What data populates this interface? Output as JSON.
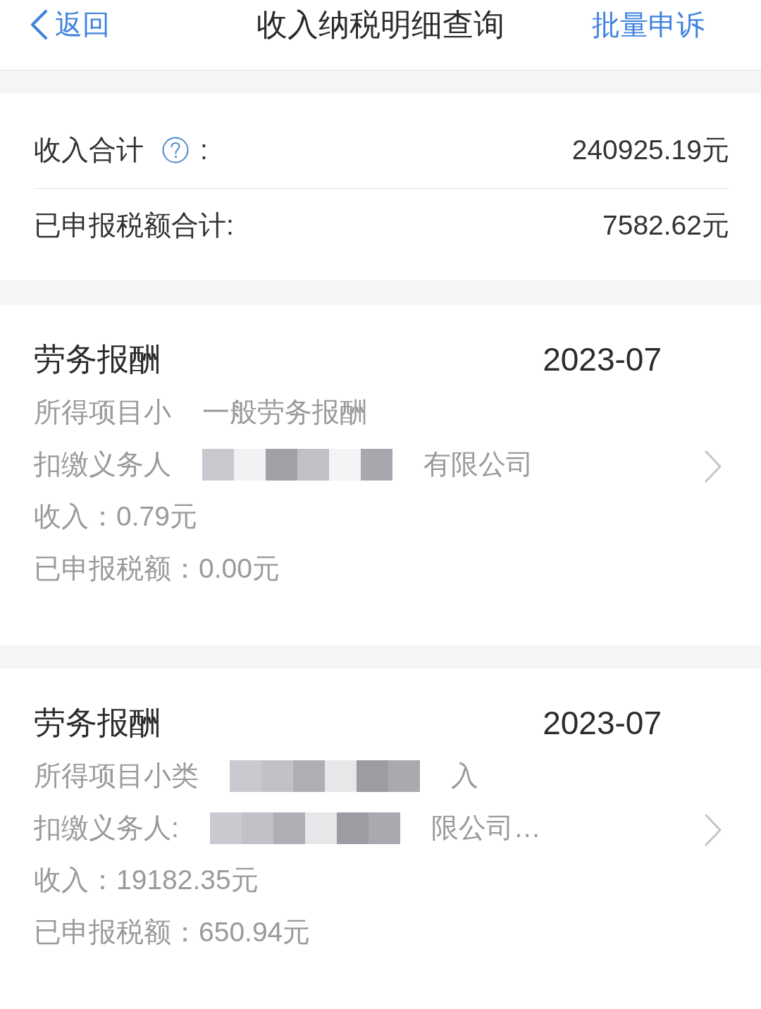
{
  "nav": {
    "back": "返回",
    "title": "收入纳税明细查询",
    "action": "批量申诉"
  },
  "summary": [
    {
      "label": "收入合计",
      "help": true,
      "suffix": ":",
      "value": "240925.19元"
    },
    {
      "label": "已申报税额合计:",
      "value": "7582.62元"
    }
  ],
  "records": [
    {
      "category": "劳务报酬",
      "period": "2023-07",
      "lines": [
        [
          {
            "kind": "text",
            "text": "所得项目小"
          },
          {
            "kind": "text",
            "text": "一般劳务报酬"
          }
        ],
        [
          {
            "kind": "text",
            "text": "扣缴义务人"
          },
          {
            "kind": "redaction"
          },
          {
            "kind": "text",
            "text": "有限公司"
          }
        ],
        [
          {
            "kind": "text",
            "text": "收入：0.79元"
          }
        ],
        [
          {
            "kind": "text",
            "text": "已申报税额：0.00元"
          }
        ]
      ]
    },
    {
      "category": "劳务报酬",
      "period": "2023-07",
      "lines": [
        [
          {
            "kind": "text",
            "text": "所得项目小类"
          },
          {
            "kind": "redaction"
          },
          {
            "kind": "text",
            "text": "入"
          }
        ],
        [
          {
            "kind": "text",
            "text": "扣缴义务人:"
          },
          {
            "kind": "redaction"
          },
          {
            "kind": "text",
            "text": "限公司…"
          }
        ],
        [
          {
            "kind": "text",
            "text": "收入：19182.35元"
          }
        ],
        [
          {
            "kind": "text",
            "text": "已申报税额：650.94元"
          }
        ]
      ]
    }
  ]
}
